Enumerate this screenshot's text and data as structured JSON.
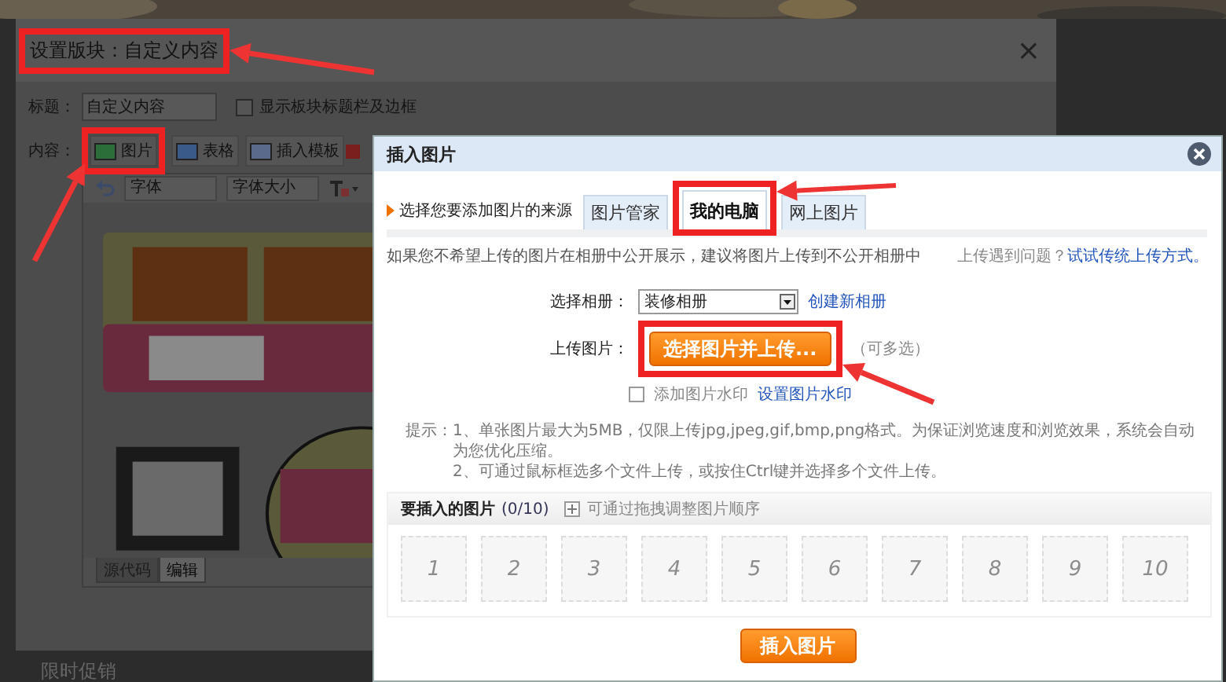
{
  "back_dialog": {
    "title": "设置版块：自定义内容",
    "close": "×",
    "title_label": "标题：",
    "title_value": "自定义内容",
    "show_border": {
      "label": "显示板块标题栏及边框",
      "checked": false
    },
    "content_label": "内容：",
    "tools": [
      {
        "label": "图片"
      },
      {
        "label": "表格",
        "kind": "table"
      },
      {
        "label": "插入模板",
        "kind": "template"
      }
    ],
    "font_select": "字体",
    "size_select": "字体大小",
    "editor_tabs": [
      {
        "label": "源代码",
        "selected": false
      },
      {
        "label": "编辑",
        "selected": true
      }
    ]
  },
  "footer_text": "限时促销",
  "insert_dialog": {
    "title": "插入图片",
    "source_label": "选择您要添加图片的来源",
    "tabs": [
      {
        "label": "图片管家",
        "selected": false
      },
      {
        "label": "我的电脑",
        "selected": true
      },
      {
        "label": "网上图片",
        "selected": false
      }
    ],
    "hint": "如果您不希望上传的图片在相册中公开展示，建议将图片上传到不公开相册中",
    "problem_text": "上传遇到问题？",
    "problem_link": "试试传统上传方式。",
    "album_label": "选择相册：",
    "album_value": "装修相册",
    "new_album_link": "创建新相册",
    "upload_label": "上传图片：",
    "upload_button": "选择图片并上传...",
    "multi_note": "（可多选）",
    "watermark": {
      "label": "添加图片水印",
      "checked": false
    },
    "watermark_link": "设置图片水印",
    "tips_label": "提示：",
    "tips": [
      "1、单张图片最大为5MB，仅限上传jpg,jpeg,gif,bmp,png格式。为保证浏览速度和浏览效果，系统会自动为您优化压缩。",
      "2、可通过鼠标框选多个文件上传，或按住Ctrl键并选择多个文件上传。"
    ],
    "queue_title": "要插入的图片",
    "queue_count": "(0/10)",
    "queue_hint": "可通过拖拽调整图片顺序",
    "slots": [
      "1",
      "2",
      "3",
      "4",
      "5",
      "6",
      "7",
      "8",
      "9",
      "10"
    ],
    "insert_button": "插入图片"
  }
}
